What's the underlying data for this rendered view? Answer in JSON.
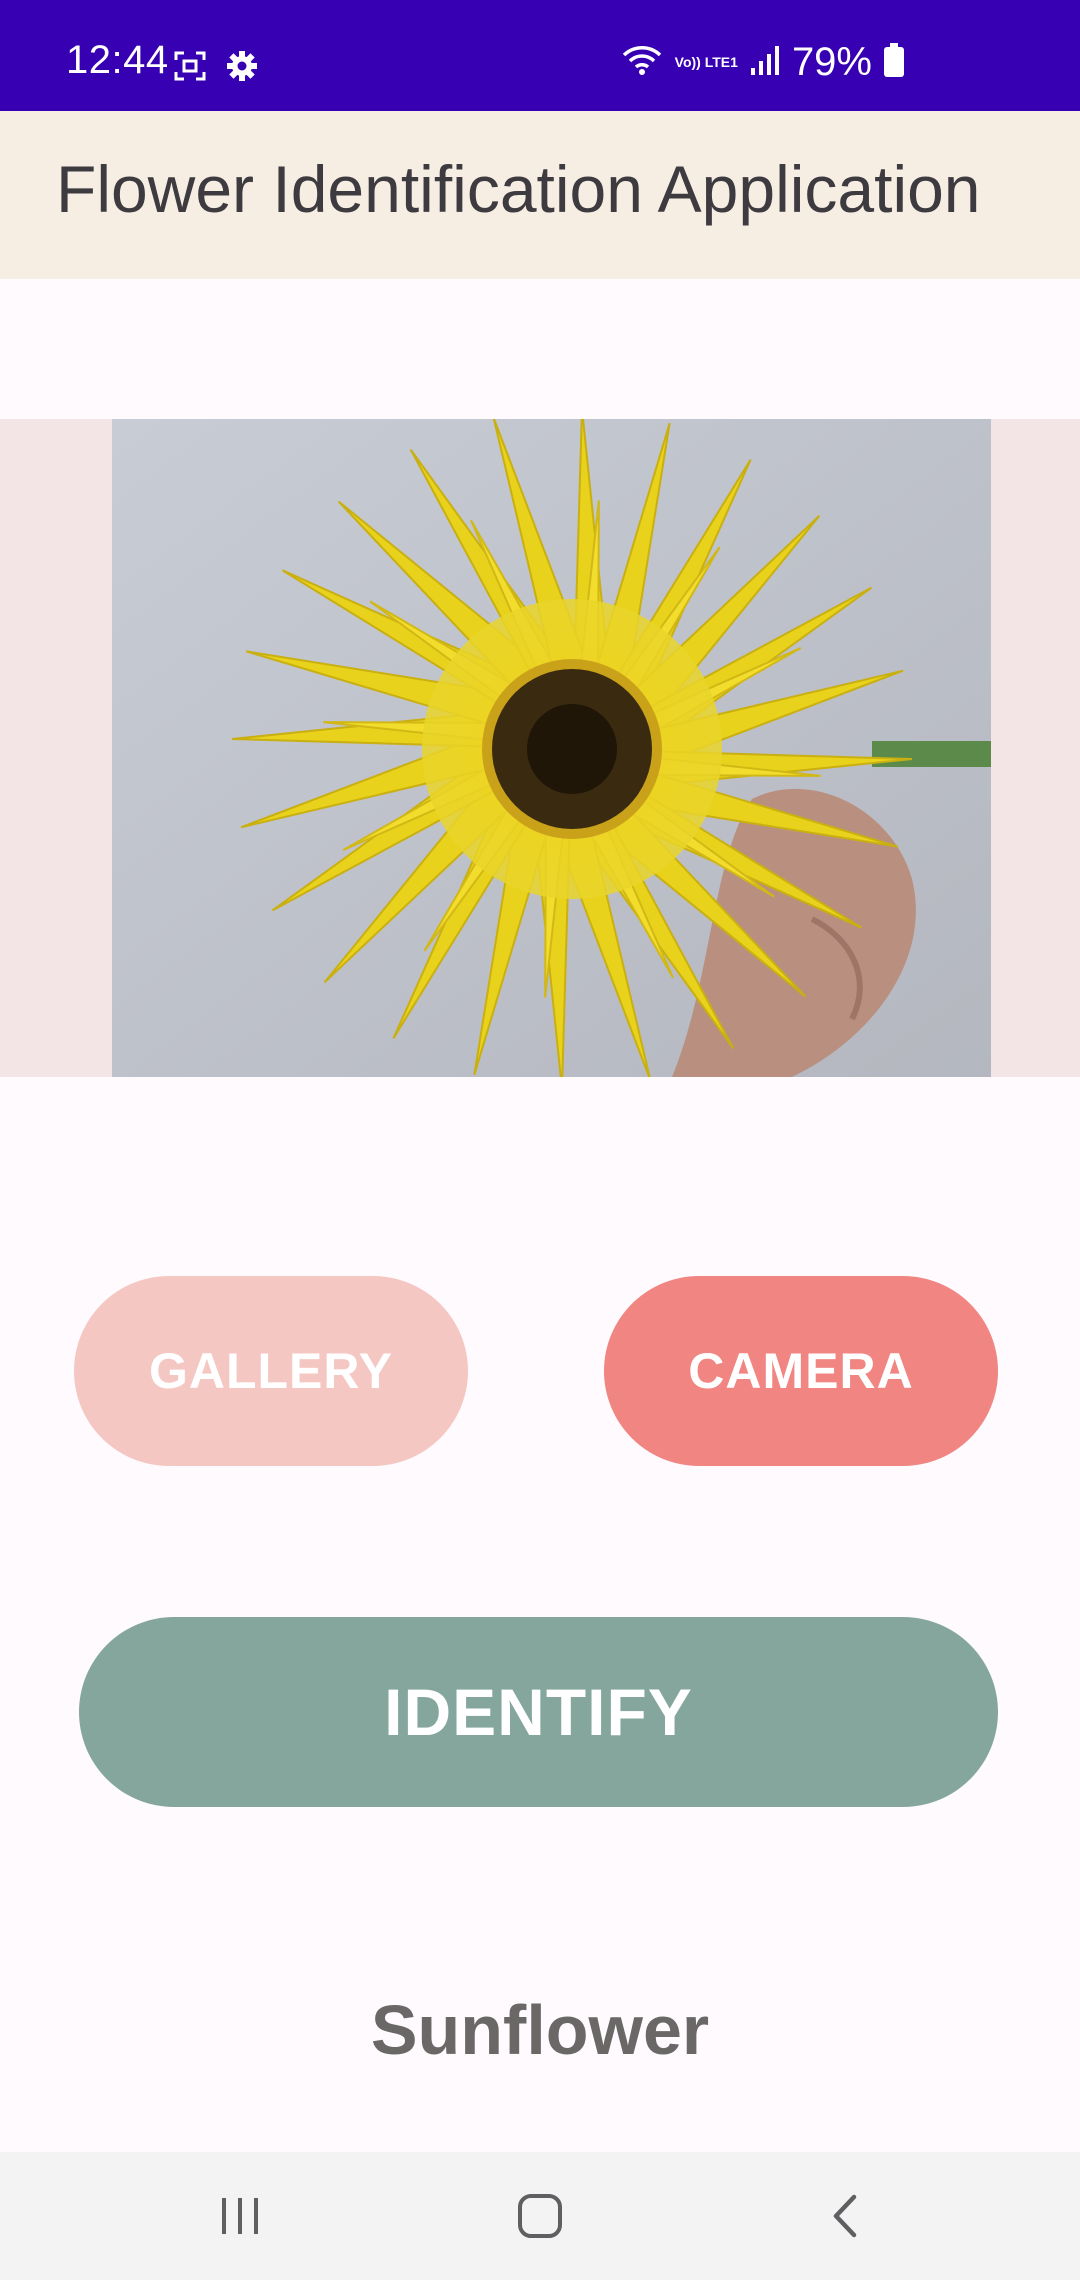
{
  "status_bar": {
    "time": "12:44",
    "network_label": "Vo)) LTE1",
    "battery_percent": "79%",
    "icons": [
      "screenshot-icon",
      "settings-icon",
      "wifi-icon",
      "volte-icon",
      "signal-icon",
      "battery-icon"
    ]
  },
  "app_bar": {
    "title": "Flower Identification Application"
  },
  "image_preview": {
    "content": "yellow gerbera flower photo"
  },
  "buttons": {
    "gallery_label": "GALLERY",
    "camera_label": "CAMERA",
    "identify_label": "IDENTIFY"
  },
  "result": {
    "label": "Sunflower"
  },
  "nav_bar": {
    "icons": [
      "recents-icon",
      "home-icon",
      "back-icon"
    ]
  },
  "colors": {
    "status_bar": "#3700b3",
    "app_bar": "#f6ede3",
    "gallery": "#f5c7c3",
    "camera": "#f08582",
    "identify": "#85a69d",
    "result_text": "#6a6767"
  }
}
